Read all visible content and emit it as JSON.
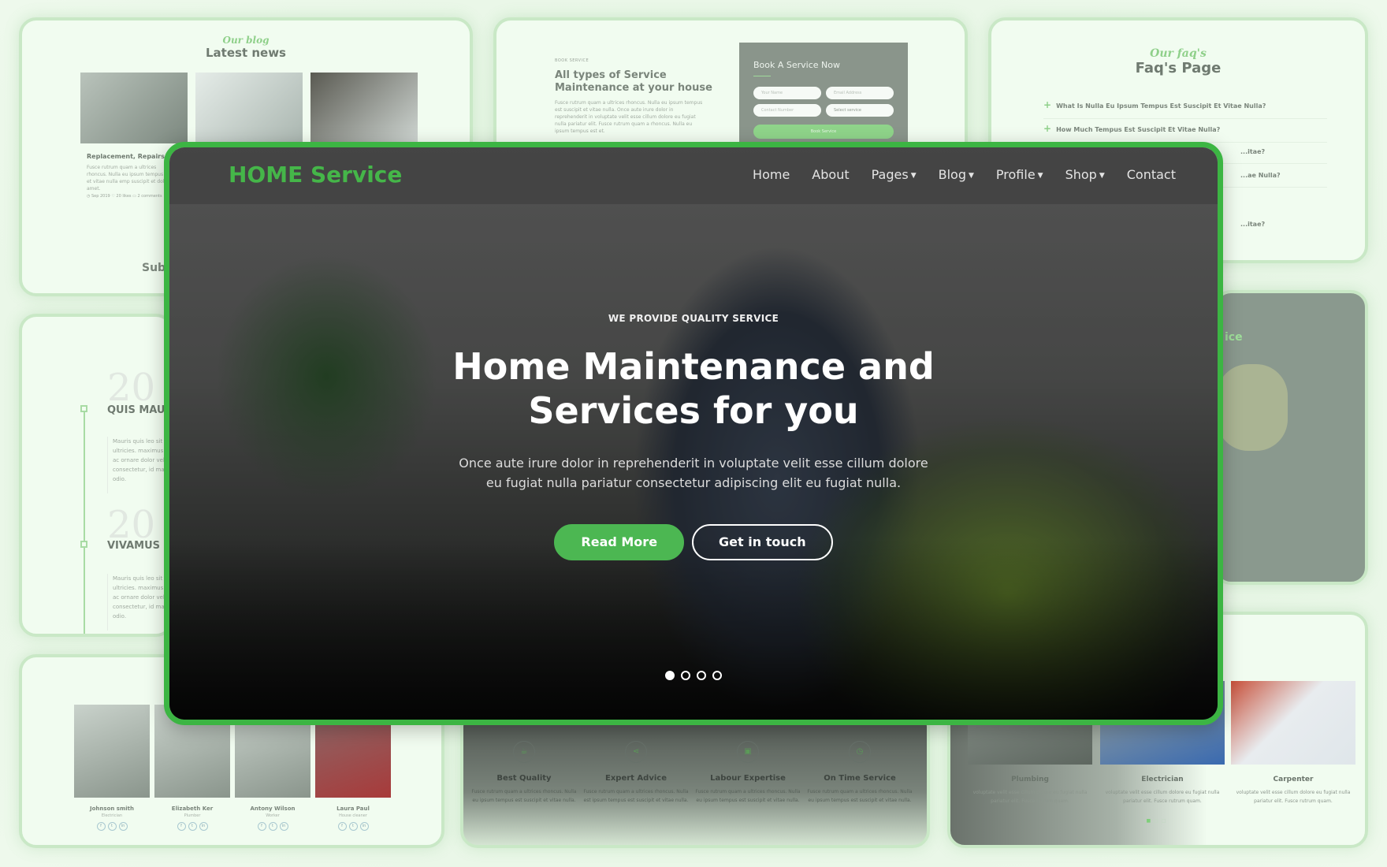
{
  "blog": {
    "eyebrow": "Our blog",
    "title": "Latest news",
    "post": {
      "title": "Replacement, Repairs.",
      "excerpt": "Fusce rutrum quam a ultrices rhoncus. Nulla eu ipsum tempus est et vitae nulla emp suscipit et dolor amet.",
      "date": "Sep 2019",
      "likes": "20 likes",
      "comments": "2 comments"
    },
    "subscribe": "Subs"
  },
  "book": {
    "label": "BOOK SERVICE",
    "title": "All types of Service Maintenance at your house",
    "description": "Fusce rutrum quam a ultrices rhoncus. Nulla eu ipsum tempus est suscipit et vitae nulla. Once aute irure dolor in reprehenderit in voluptate velit esse cillum dolore eu fugiat nulla pariatur elit. Fusce rutrum quam a rhoncus. Nulla eu ipsum tempus est et.",
    "form_title": "Book A Service Now",
    "name_placeholder": "Your Name",
    "email_placeholder": "Email Address",
    "phone_placeholder": "Contact Number",
    "service_select": "Select service",
    "submit": "Book Service"
  },
  "faq": {
    "eyebrow": "Our faq's",
    "title": "Faq's Page",
    "items": [
      "What Is Nulla Eu Ipsum Tempus Est Suscipit Et Vitae Nulla?",
      "How Much Tempus Est Suscipit Et Vitae Nulla?",
      "...itae?",
      "...ae Nulla?",
      "...itae?"
    ]
  },
  "about_card": {
    "title_fragment": "ice"
  },
  "timeline": {
    "entries": [
      {
        "year": "20",
        "title": "QUIS MAURIS VULPUTATE",
        "body": "Mauris quis leo sit hendrerit ultricies. maximus enim dolor ac ornare dolor velit consectetur, id max erat mollis odio."
      },
      {
        "year": "20",
        "title": "VIVAMUS U FINIBUS SO",
        "body": "Mauris quis leo sit hendrerit ultricies. maximus enim dolor ac ornare dolor velit consectetur, id max erat mollis odio."
      }
    ]
  },
  "team": {
    "members": [
      {
        "name": "Johnson smith",
        "role": "Electrician"
      },
      {
        "name": "Elizabeth Ker",
        "role": "Plumber"
      },
      {
        "name": "Antony Wilson",
        "role": "Worker"
      },
      {
        "name": "Laura Paul",
        "role": "House cleaner"
      }
    ],
    "social": [
      "f",
      "t",
      "in"
    ]
  },
  "features": [
    {
      "icon": "cup-icon",
      "glyph": "☕",
      "title": "Best Quality",
      "desc": "Fusce rutrum quam a ultrices rhoncus. Nulla eu ipsum tempus est suscipit et vitae nulla."
    },
    {
      "icon": "share-icon",
      "glyph": "⋖",
      "title": "Expert Advice",
      "desc": "Fusce rutrum quam a ultrices rhoncus. Nulla est ipsum tempus est suscipit et vitae nulla."
    },
    {
      "icon": "basket-icon",
      "glyph": "▣",
      "title": "Labour Expertise",
      "desc": "Fusce rutrum quam a ultrices rhoncus. Nulla eu ipsum tempus est suscipit et vitae nulla."
    },
    {
      "icon": "clock-icon",
      "glyph": "◷",
      "title": "On Time Service",
      "desc": "Fusce rutrum quam a ultrices rhoncus. Nulla eu ipsum tempus est suscipit et vitae nulla."
    }
  ],
  "services": {
    "items": [
      {
        "title": "Plumbing",
        "desc": "voluptate velit esse cillum dolore eu fugiat nulla pariatur elit. Fusce rutrum quam."
      },
      {
        "title": "Electrician",
        "desc": "voluptate velit esse cillum dolore eu fugiat nulla pariatur elit. Fusce rutrum quam."
      },
      {
        "title": "Carpenter",
        "desc": "voluptate velit esse cillum dolore eu fugiat nulla pariatur elit. Fusce rutrum quam."
      }
    ],
    "pager": {
      "total": 3,
      "active": 1
    }
  },
  "hero": {
    "brand": "HOME Service",
    "nav": [
      {
        "label": "Home",
        "dropdown": false
      },
      {
        "label": "About",
        "dropdown": false
      },
      {
        "label": "Pages",
        "dropdown": true
      },
      {
        "label": "Blog",
        "dropdown": true
      },
      {
        "label": "Profile",
        "dropdown": true
      },
      {
        "label": "Shop",
        "dropdown": true
      },
      {
        "label": "Contact",
        "dropdown": false
      }
    ],
    "eyebrow": "WE PROVIDE QUALITY SERVICE",
    "title_line1": "Home Maintenance and",
    "title_line2": "Services for you",
    "description": "Once aute irure dolor in reprehenderit in voluptate velit esse cillum dolore eu fugiat nulla pariatur consectetur adipiscing elit eu fugiat nulla.",
    "primary_button": "Read More",
    "secondary_button": "Get in touch",
    "slides": {
      "total": 4,
      "active": 1
    },
    "accent_color": "#3cb543"
  }
}
